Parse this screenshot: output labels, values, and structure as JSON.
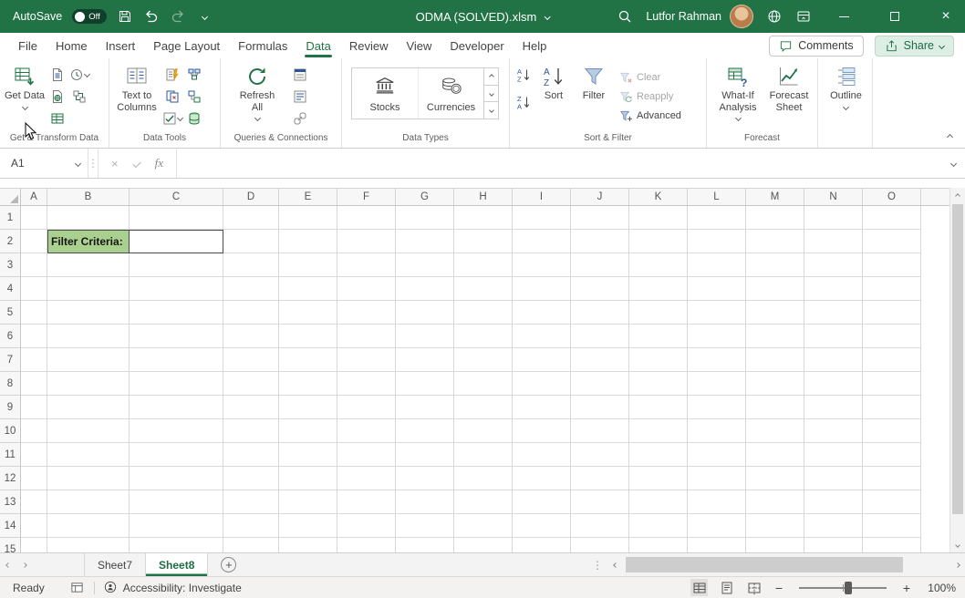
{
  "accent": {
    "green": "#217346",
    "cell_fill": "#A9D08E"
  },
  "title_bar": {
    "autosave_label": "AutoSave",
    "autosave_state": "Off",
    "document_title": "ODMA (SOLVED).xlsm",
    "user_name": "Lutfor Rahman"
  },
  "menu": {
    "tabs": [
      {
        "label": "File",
        "active": false
      },
      {
        "label": "Home",
        "active": false
      },
      {
        "label": "Insert",
        "active": false
      },
      {
        "label": "Page Layout",
        "active": false
      },
      {
        "label": "Formulas",
        "active": false
      },
      {
        "label": "Data",
        "active": true
      },
      {
        "label": "Review",
        "active": false
      },
      {
        "label": "View",
        "active": false
      },
      {
        "label": "Developer",
        "active": false
      },
      {
        "label": "Help",
        "active": false
      }
    ],
    "comments_label": "Comments",
    "share_label": "Share"
  },
  "ribbon": {
    "get_transform": {
      "label": "Get & Transform Data",
      "get_data_label": "Get Data"
    },
    "data_tools": {
      "label": "Data Tools",
      "text_to_columns_label": "Text to Columns"
    },
    "queries": {
      "label": "Queries & Connections",
      "refresh_all_label": "Refresh All"
    },
    "data_types": {
      "label": "Data Types",
      "stocks_label": "Stocks",
      "currencies_label": "Currencies"
    },
    "sort_filter": {
      "label": "Sort & Filter",
      "sort_label": "Sort",
      "filter_label": "Filter",
      "clear_label": "Clear",
      "reapply_label": "Reapply",
      "advanced_label": "Advanced"
    },
    "forecast": {
      "label": "Forecast",
      "what_if_label": "What-If Analysis",
      "forecast_sheet_label": "Forecast Sheet"
    },
    "outline": {
      "outline_label": "Outline"
    }
  },
  "formula_bar": {
    "name_box": "A1",
    "fx_label": "fx",
    "value": ""
  },
  "grid": {
    "columns": [
      "A",
      "B",
      "C",
      "D",
      "E",
      "F",
      "G",
      "H",
      "I",
      "J",
      "K",
      "L",
      "M",
      "N",
      "O"
    ],
    "rows": [
      "1",
      "2",
      "3",
      "4",
      "5",
      "6",
      "7",
      "8",
      "9",
      "10",
      "11",
      "12",
      "13",
      "14",
      "15"
    ],
    "cells": [
      {
        "col": "B",
        "row": "2",
        "text": "Filter Criteria:",
        "fill": "#A9D08E",
        "bold": true,
        "bordered": true
      },
      {
        "col": "C",
        "row": "2",
        "text": "",
        "fill": "#FFFFFF",
        "bold": false,
        "bordered": true
      }
    ]
  },
  "sheet_bar": {
    "tabs": [
      {
        "name": "Sheet7",
        "active": false
      },
      {
        "name": "Sheet8",
        "active": true
      }
    ],
    "add_label": "+"
  },
  "status_bar": {
    "ready": "Ready",
    "accessibility": "Accessibility: Investigate",
    "zoom_level": "100%"
  }
}
